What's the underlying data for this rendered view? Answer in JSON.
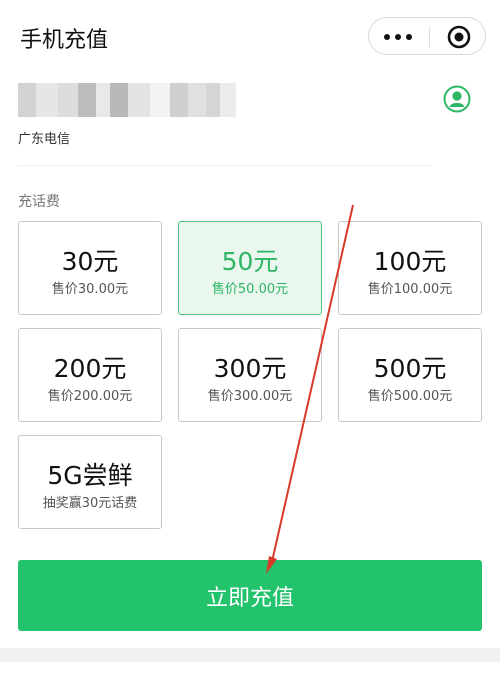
{
  "header": {
    "title": "手机充值",
    "menu_icon": "more-dots-icon",
    "close_icon": "target-icon"
  },
  "account": {
    "region": "广东电信",
    "avatar_icon": "user-avatar-icon"
  },
  "section": {
    "label": "充话费"
  },
  "options": [
    {
      "amount": "30元",
      "price": "售价30.00元",
      "selected": false
    },
    {
      "amount": "50元",
      "price": "售价50.00元",
      "selected": true
    },
    {
      "amount": "100元",
      "price": "售价100.00元",
      "selected": false
    },
    {
      "amount": "200元",
      "price": "售价200.00元",
      "selected": false
    },
    {
      "amount": "300元",
      "price": "售价300.00元",
      "selected": false
    },
    {
      "amount": "500元",
      "price": "售价500.00元",
      "selected": false
    },
    {
      "amount": "5G尝鲜",
      "price": "抽奖赢30元话费",
      "selected": false
    }
  ],
  "cta": {
    "label": "立即充值"
  },
  "colors": {
    "accent": "#23c26c",
    "selected_text": "#2fb665",
    "selected_bg": "#eaf7ef",
    "annotation_arrow": "#d93a2b"
  }
}
